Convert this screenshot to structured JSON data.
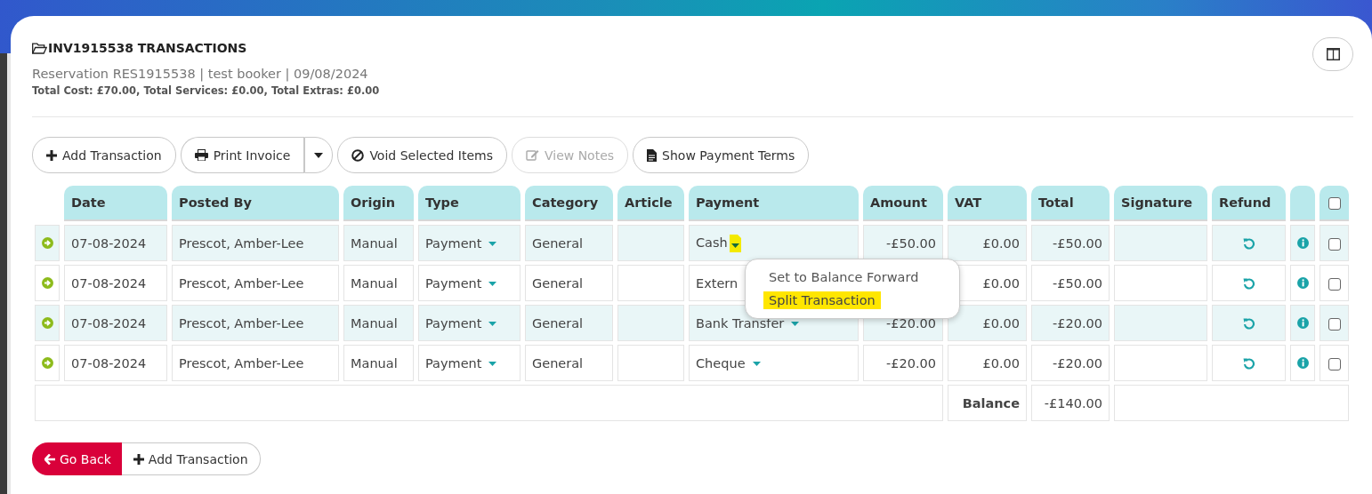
{
  "header": {
    "title": "INV1915538 TRANSACTIONS",
    "subtitle": "Reservation RES1915538 | test booker | 09/08/2024",
    "totals": "Total Cost: £70.00, Total Services: £0.00, Total Extras: £0.00"
  },
  "toolbar": [
    {
      "kind": "add",
      "label": "Add Transaction",
      "disabled": false,
      "has_menu": false
    },
    {
      "kind": "print",
      "label": "Print Invoice",
      "disabled": false,
      "has_menu": true
    },
    {
      "kind": "void",
      "label": "Void Selected Items",
      "disabled": false,
      "has_menu": false
    },
    {
      "kind": "notes",
      "label": "View Notes",
      "disabled": true,
      "has_menu": false
    },
    {
      "kind": "terms",
      "label": "Show Payment Terms",
      "disabled": false,
      "has_menu": false
    }
  ],
  "table": {
    "columns": [
      "Date",
      "Posted By",
      "Origin",
      "Type",
      "Category",
      "Article",
      "Payment",
      "Amount",
      "VAT",
      "Total",
      "Signature",
      "Refund"
    ],
    "select_all": {
      "checked": false
    },
    "rows": [
      {
        "date": "07-08-2024",
        "posted_by": "Prescot, Amber-Lee",
        "origin": "Manual",
        "type": "Payment",
        "category": "General",
        "payment": "Cash",
        "caret_shown": true,
        "caret_highlighted": true,
        "amount": "-£50.00",
        "vat": "£0.00",
        "total": "-£50.00",
        "checked": false
      },
      {
        "date": "07-08-2024",
        "posted_by": "Prescot, Amber-Lee",
        "origin": "Manual",
        "type": "Payment",
        "category": "General",
        "payment": "Extern",
        "caret_shown": false,
        "caret_highlighted": false,
        "vat": "£0.00",
        "total": "-£50.00",
        "checked": false
      },
      {
        "date": "07-08-2024",
        "posted_by": "Prescot, Amber-Lee",
        "origin": "Manual",
        "type": "Payment",
        "category": "General",
        "payment": "Bank Transfer",
        "caret_shown": true,
        "caret_highlighted": false,
        "amount": "-£20.00",
        "vat": "£0.00",
        "total": "-£20.00",
        "checked": false
      },
      {
        "date": "07-08-2024",
        "posted_by": "Prescot, Amber-Lee",
        "origin": "Manual",
        "type": "Payment",
        "category": "General",
        "payment": "Cheque",
        "caret_shown": true,
        "caret_highlighted": false,
        "amount": "-£20.00",
        "vat": "£0.00",
        "total": "-£20.00",
        "checked": false
      }
    ],
    "balance": {
      "label": "Balance",
      "value": "-£140.00"
    }
  },
  "payment_menu": {
    "items": [
      {
        "label": "Set to Balance Forward",
        "highlighted": false
      },
      {
        "label": "Split Transaction",
        "highlighted": true
      }
    ]
  },
  "footer": {
    "back": "Go Back",
    "add": "Add Transaction"
  }
}
